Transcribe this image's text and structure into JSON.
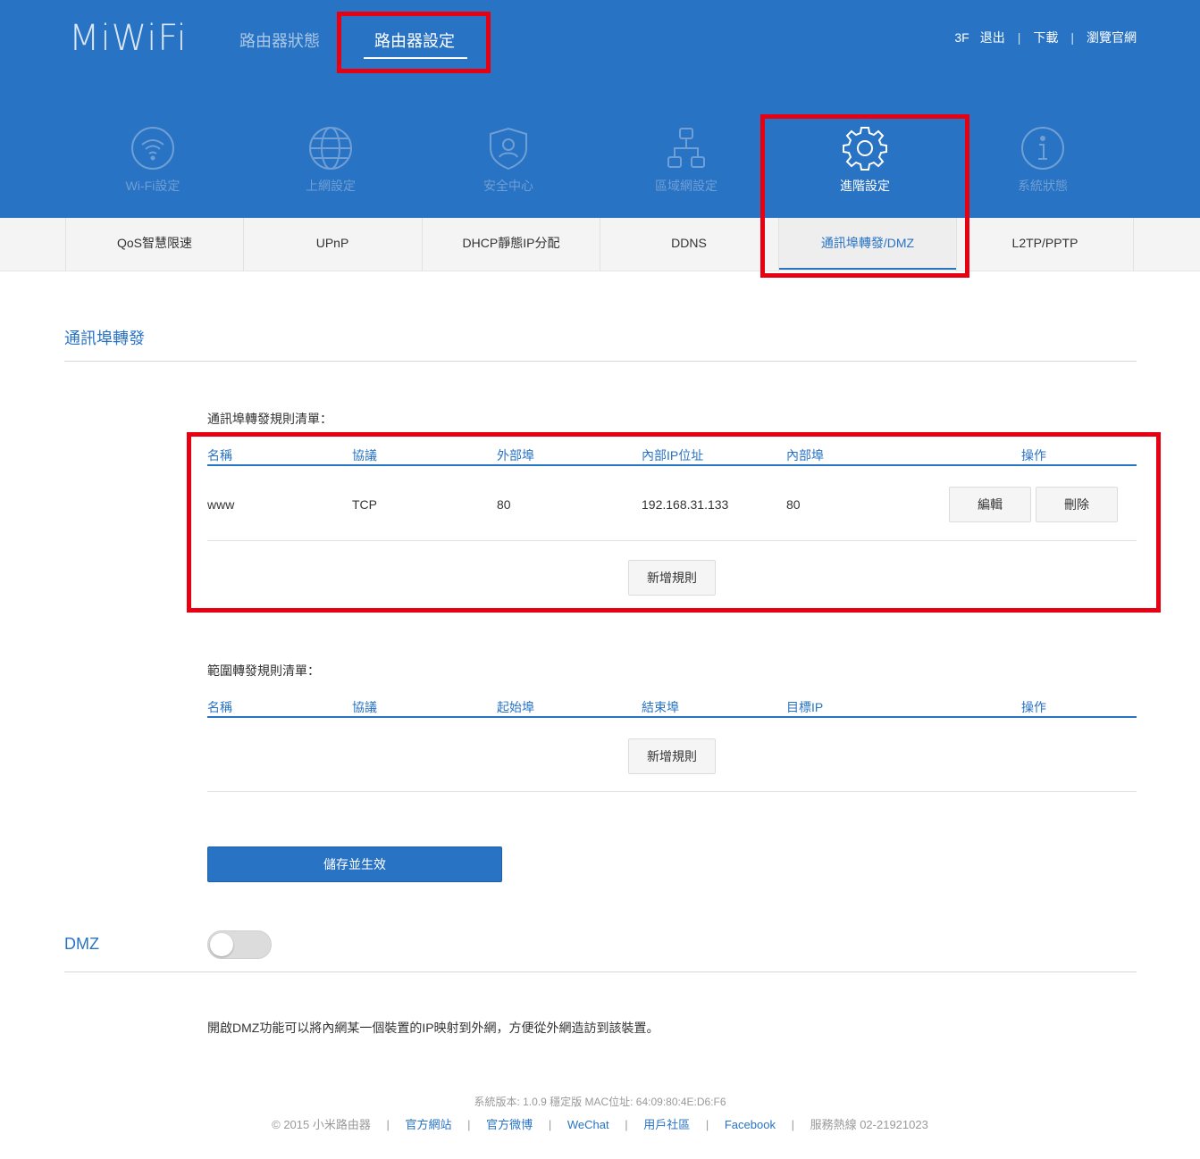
{
  "header": {
    "logo": "MiWiFi",
    "nav": [
      {
        "label": "路由器狀態"
      },
      {
        "label": "路由器設定"
      }
    ],
    "user": "3F",
    "links": [
      "退出",
      "下載",
      "瀏覽官網"
    ],
    "separator": "|"
  },
  "modules": [
    {
      "label": "Wi-Fi設定",
      "icon": "wifi-icon"
    },
    {
      "label": "上網設定",
      "icon": "globe-icon"
    },
    {
      "label": "安全中心",
      "icon": "shield-user-icon"
    },
    {
      "label": "區域網設定",
      "icon": "network-icon"
    },
    {
      "label": "進階設定",
      "icon": "gear-icon",
      "active": true
    },
    {
      "label": "系統狀態",
      "icon": "info-icon"
    }
  ],
  "subtabs": [
    "QoS智慧限速",
    "UPnP",
    "DHCP靜態IP分配",
    "DDNS",
    "通訊埠轉發/DMZ",
    "L2TP/PPTP"
  ],
  "port_forward": {
    "section_title": "通訊埠轉發",
    "list_title": "通訊埠轉發規則清單：",
    "headers": [
      "名稱",
      "協議",
      "外部埠",
      "內部IP位址",
      "內部埠",
      "操作"
    ],
    "rows": [
      {
        "name": "www",
        "protocol": "TCP",
        "ext_port": "80",
        "ip": "192.168.31.133",
        "int_port": "80",
        "edit": "編輯",
        "delete": "刪除"
      }
    ],
    "add_button": "新增規則"
  },
  "range_forward": {
    "list_title": "範圍轉發規則清單：",
    "headers": [
      "名稱",
      "協議",
      "起始埠",
      "結束埠",
      "目標IP",
      "操作"
    ],
    "add_button": "新增規則"
  },
  "save_button": "儲存並生效",
  "dmz": {
    "title": "DMZ",
    "enabled": false,
    "description": "開啟DMZ功能可以將內網某一個裝置的IP映射到外網，方便從外網造訪到該裝置。"
  },
  "footer": {
    "version_line": "系統版本: 1.0.9 穩定版  MAC位址: 64:09:80:4E:D6:F6",
    "copyright": "© 2015 小米路由器",
    "links": [
      "官方網站",
      "官方微博",
      "WeChat",
      "用戶社區",
      "Facebook"
    ],
    "hotline": "服務熱線 02-21921023"
  },
  "colors": {
    "brand": "#2873c4",
    "highlight": "#e60012"
  }
}
